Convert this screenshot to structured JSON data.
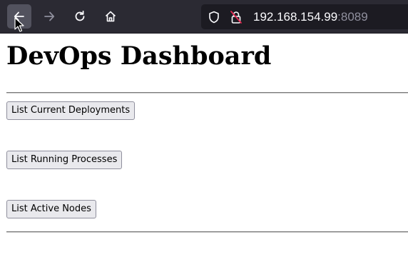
{
  "browser": {
    "nav_icons": [
      "back-arrow-icon",
      "forward-arrow-icon",
      "reload-icon",
      "home-icon"
    ],
    "address_bar": {
      "host": "192.168.154.99",
      "port": ":8089",
      "icons": [
        "shield-icon",
        "insecure-lock-icon"
      ]
    },
    "colors": {
      "toolbar_bg": "#2b2a33",
      "urlbar_bg": "#1c1b22",
      "active_button_bg": "#52525e",
      "insecure_slash": "#e22850"
    }
  },
  "page": {
    "title": "DevOps Dashboard",
    "buttons": [
      {
        "label": "List Current Deployments"
      },
      {
        "label": "List Running Processes"
      },
      {
        "label": "List Active Nodes"
      }
    ]
  }
}
